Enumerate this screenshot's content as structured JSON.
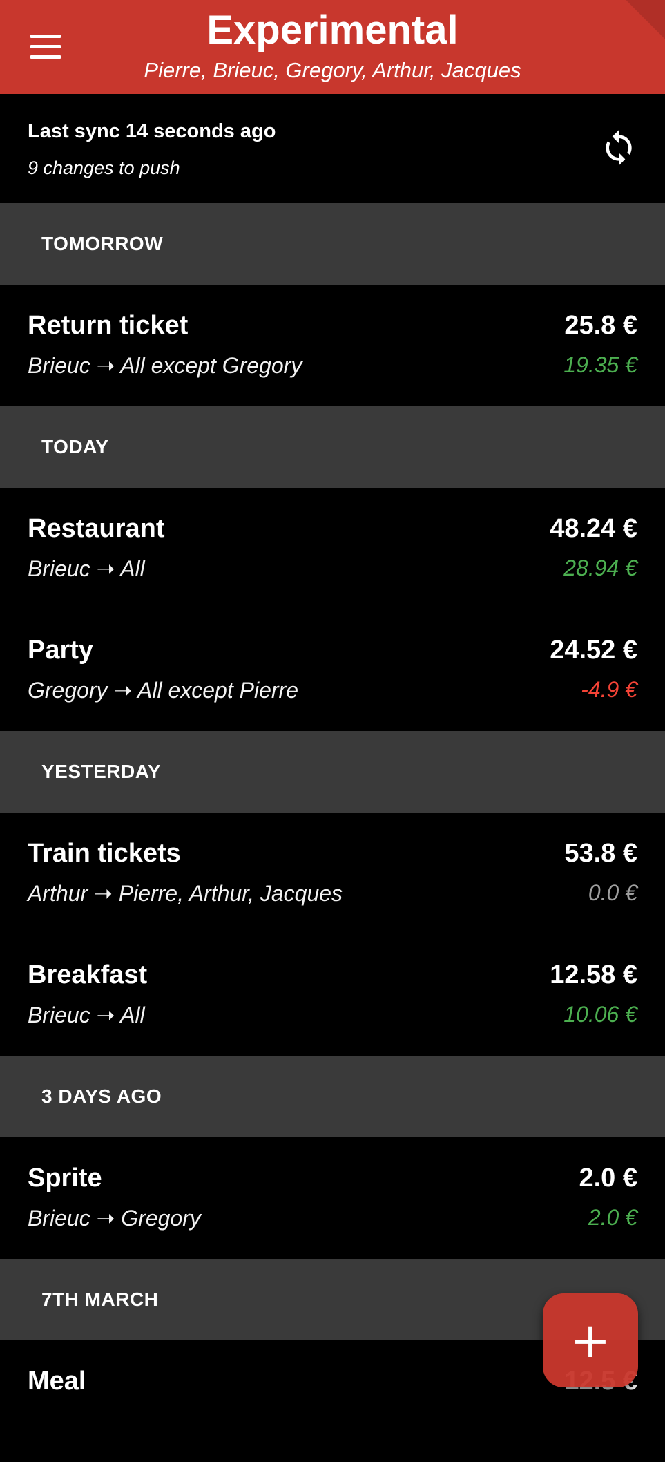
{
  "appbar": {
    "title": "Experimental",
    "subtitle": "Pierre, Brieuc, Gregory, Arthur, Jacques",
    "color": "#c8372d"
  },
  "sync": {
    "status": "Last sync 14 seconds ago",
    "pending": "9 changes to push",
    "icon": "sync-icon"
  },
  "colors": {
    "positive": "#4caf50",
    "negative": "#f44336",
    "neutral": "#9e9e9e",
    "section_bg": "#3a3a3a"
  },
  "sections": [
    {
      "label": "TOMORROW",
      "items": [
        {
          "name": "Return ticket",
          "who": "Brieuc ➝ All except Gregory",
          "amount": "25.8 €",
          "balance": "19.35 €",
          "balance_kind": "positive"
        }
      ]
    },
    {
      "label": "TODAY",
      "items": [
        {
          "name": "Restaurant",
          "who": "Brieuc ➝ All",
          "amount": "48.24 €",
          "balance": "28.94 €",
          "balance_kind": "positive"
        },
        {
          "name": "Party",
          "who": "Gregory ➝ All except Pierre",
          "amount": "24.52 €",
          "balance": "-4.9 €",
          "balance_kind": "negative"
        }
      ]
    },
    {
      "label": "YESTERDAY",
      "items": [
        {
          "name": "Train tickets",
          "who": "Arthur ➝ Pierre, Arthur, Jacques",
          "amount": "53.8 €",
          "balance": "0.0 €",
          "balance_kind": "neutral"
        },
        {
          "name": "Breakfast",
          "who": "Brieuc ➝ All",
          "amount": "12.58 €",
          "balance": "10.06 €",
          "balance_kind": "positive"
        }
      ]
    },
    {
      "label": "3 DAYS AGO",
      "items": [
        {
          "name": "Sprite",
          "who": "Brieuc ➝ Gregory",
          "amount": "2.0 €",
          "balance": "2.0 €",
          "balance_kind": "positive"
        }
      ]
    },
    {
      "label": "7TH MARCH",
      "items": [
        {
          "name": "Meal",
          "who": "",
          "amount": "12.5 €",
          "balance": "",
          "balance_kind": "positive"
        }
      ]
    }
  ],
  "fab": {
    "label": "+",
    "icon": "plus-icon"
  }
}
